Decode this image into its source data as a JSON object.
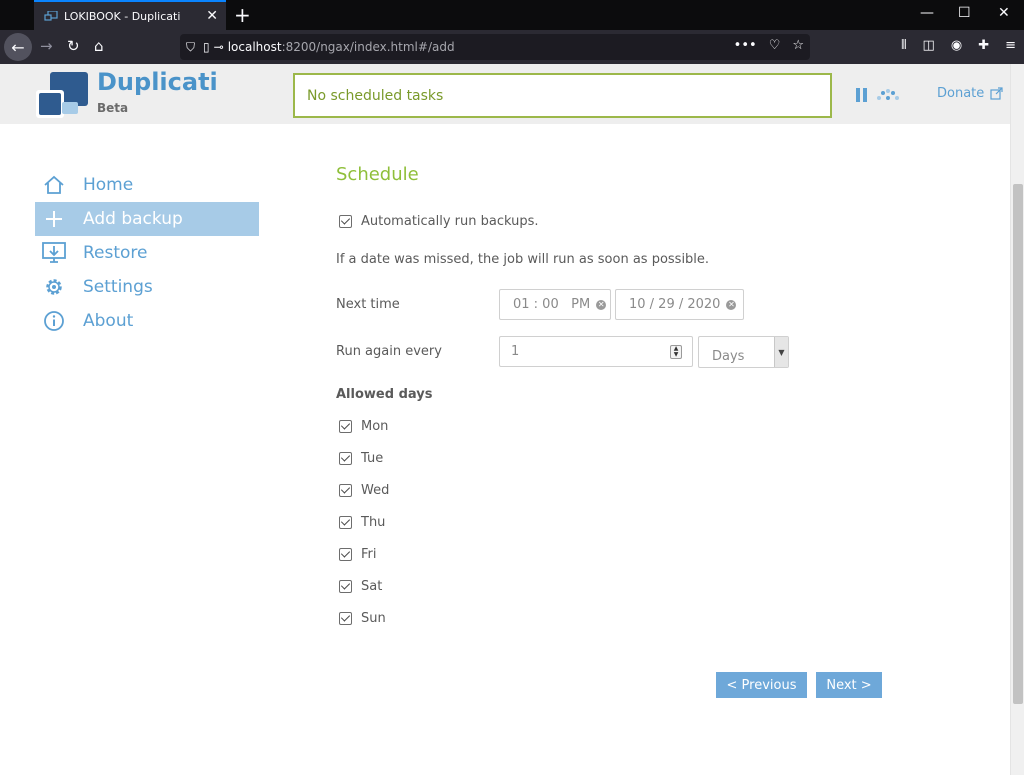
{
  "browser": {
    "tab_title": "LOKIBOOK - Duplicati",
    "url_host": "localhost",
    "url_rest": ":8200/ngax/index.html#/add"
  },
  "header": {
    "brand": "Duplicati",
    "brand_sub": "Beta",
    "status": "No scheduled tasks",
    "donate": "Donate"
  },
  "sidebar": {
    "items": [
      {
        "label": "Home",
        "icon": "home-icon",
        "active": false
      },
      {
        "label": "Add backup",
        "icon": "plus-icon",
        "active": true
      },
      {
        "label": "Restore",
        "icon": "restore-icon",
        "active": false
      },
      {
        "label": "Settings",
        "icon": "gear-icon",
        "active": false
      },
      {
        "label": "About",
        "icon": "info-icon",
        "active": false
      }
    ]
  },
  "schedule": {
    "title": "Schedule",
    "auto_run_label": "Automatically run backups.",
    "auto_run_checked": true,
    "missed_note": "If a date was missed, the job will run as soon as possible.",
    "next_time_label": "Next time",
    "time_value": "01 : 00   PM",
    "date_value": "10 / 29 / 2020",
    "run_again_label": "Run again every",
    "run_again_value": "1",
    "run_again_unit": "Days",
    "allowed_days_label": "Allowed days",
    "days": [
      {
        "label": "Mon",
        "checked": true
      },
      {
        "label": "Tue",
        "checked": true
      },
      {
        "label": "Wed",
        "checked": true
      },
      {
        "label": "Thu",
        "checked": true
      },
      {
        "label": "Fri",
        "checked": true
      },
      {
        "label": "Sat",
        "checked": true
      },
      {
        "label": "Sun",
        "checked": true
      }
    ]
  },
  "buttons": {
    "previous": "< Previous",
    "next": "Next >"
  },
  "colors": {
    "accent_blue": "#5ca0d3",
    "schedule_green": "#8fbf3a",
    "status_border": "#9cb84a",
    "active_item": "#a7cbe7",
    "button_blue": "#6ea8d9"
  }
}
